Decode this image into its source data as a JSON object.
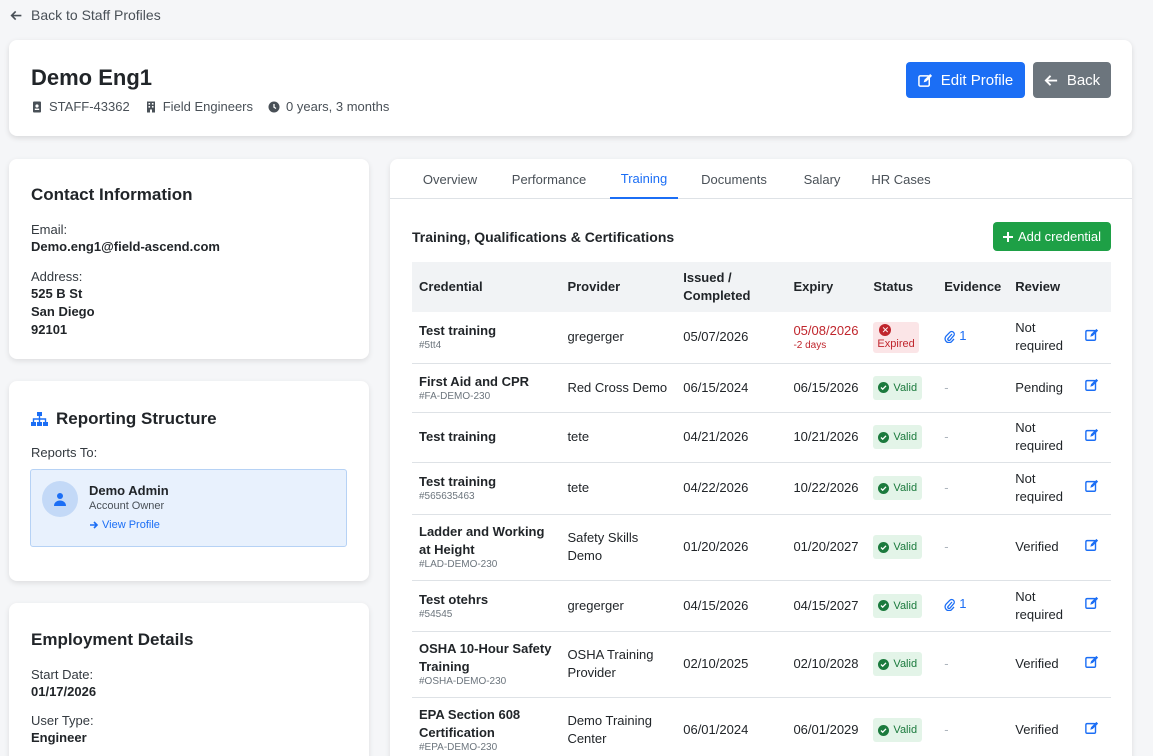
{
  "back_link": "Back to Staff Profiles",
  "header": {
    "name": "Demo Eng1",
    "staff_id": "STAFF-43362",
    "department": "Field Engineers",
    "tenure": "0 years, 3 months",
    "edit_label": "Edit Profile",
    "back_label": "Back"
  },
  "contact": {
    "title": "Contact Information",
    "email_label": "Email:",
    "email": "Demo.eng1@field-ascend.com",
    "address_label": "Address:",
    "address_line1": "525 B St",
    "address_line2": "San Diego",
    "address_line3": "92101"
  },
  "reporting": {
    "title": "Reporting Structure",
    "reports_to_label": "Reports To:",
    "manager_name": "Demo Admin",
    "manager_role": "Account Owner",
    "view_profile": "View Profile"
  },
  "employment": {
    "title": "Employment Details",
    "start_label": "Start Date:",
    "start_date": "01/17/2026",
    "user_type_label": "User Type:",
    "user_type": "Engineer"
  },
  "tabs": [
    "Overview",
    "Performance",
    "Training",
    "Documents",
    "Salary",
    "HR Cases"
  ],
  "training": {
    "title": "Training, Qualifications & Certifications",
    "add_label": "Add credential",
    "columns": [
      "Credential",
      "Provider",
      "Issued / Completed",
      "Expiry",
      "Status",
      "Evidence",
      "Review"
    ],
    "rows": [
      {
        "name": "Test training",
        "id": "#5tt4",
        "provider": "gregerger",
        "issued": "05/07/2026",
        "expiry": "05/08/2026",
        "expiry_note": "-2 days",
        "status": "Expired",
        "evidence": "1",
        "review": "Not required"
      },
      {
        "name": "First Aid and CPR",
        "id": "#FA-DEMO-230",
        "provider": "Red Cross Demo",
        "issued": "06/15/2024",
        "expiry": "06/15/2026",
        "expiry_note": "",
        "status": "Valid",
        "evidence": "-",
        "review": "Pending"
      },
      {
        "name": "Test training",
        "id": "",
        "provider": "tete",
        "issued": "04/21/2026",
        "expiry": "10/21/2026",
        "expiry_note": "",
        "status": "Valid",
        "evidence": "-",
        "review": "Not required"
      },
      {
        "name": "Test training",
        "id": "#565635463",
        "provider": "tete",
        "issued": "04/22/2026",
        "expiry": "10/22/2026",
        "expiry_note": "",
        "status": "Valid",
        "evidence": "-",
        "review": "Not required"
      },
      {
        "name": "Ladder and Working at Height",
        "id": "#LAD-DEMO-230",
        "provider": "Safety Skills Demo",
        "issued": "01/20/2026",
        "expiry": "01/20/2027",
        "expiry_note": "",
        "status": "Valid",
        "evidence": "-",
        "review": "Verified"
      },
      {
        "name": "Test otehrs",
        "id": "#54545",
        "provider": "gregerger",
        "issued": "04/15/2026",
        "expiry": "04/15/2027",
        "expiry_note": "",
        "status": "Valid",
        "evidence": "1",
        "review": "Not required"
      },
      {
        "name": "OSHA 10-Hour Safety Training",
        "id": "#OSHA-DEMO-230",
        "provider": "OSHA Training Provider",
        "issued": "02/10/2025",
        "expiry": "02/10/2028",
        "expiry_note": "",
        "status": "Valid",
        "evidence": "-",
        "review": "Verified"
      },
      {
        "name": "EPA Section 608 Certification",
        "id": "#EPA-DEMO-230",
        "provider": "Demo Training Center",
        "issued": "06/01/2024",
        "expiry": "06/01/2029",
        "expiry_note": "",
        "status": "Valid",
        "evidence": "-",
        "review": "Verified"
      }
    ]
  }
}
